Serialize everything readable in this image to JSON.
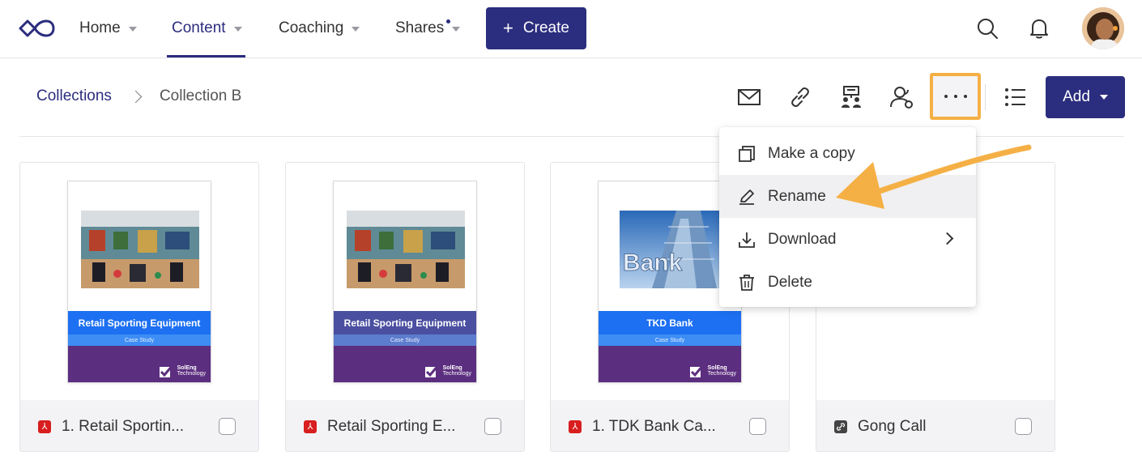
{
  "nav": {
    "items": [
      {
        "label": "Home"
      },
      {
        "label": "Content"
      },
      {
        "label": "Coaching"
      },
      {
        "label": "Shares"
      }
    ],
    "create_label": "Create"
  },
  "breadcrumb": {
    "parent": "Collections",
    "current": "Collection B"
  },
  "toolbar": {
    "add_label": "Add"
  },
  "menu": {
    "items": [
      {
        "label": "Make a copy",
        "icon": "copy-icon"
      },
      {
        "label": "Rename",
        "icon": "pencil-icon"
      },
      {
        "label": "Download",
        "icon": "download-icon"
      },
      {
        "label": "Delete",
        "icon": "trash-icon"
      }
    ]
  },
  "cards": [
    {
      "title": "1. Retail Sportin...",
      "file_type": "pdf",
      "doc_title": "Retail Sporting Equipment",
      "doc_sub": "Case Study",
      "logo_line1": "SolEng",
      "logo_line2": "Technology"
    },
    {
      "title": "Retail Sporting E...",
      "file_type": "pdf",
      "doc_title": "Retail Sporting Equipment",
      "doc_sub": "Case Study",
      "logo_line1": "SolEng",
      "logo_line2": "Technology"
    },
    {
      "title": "1. TDK Bank Ca...",
      "file_type": "pdf",
      "doc_title": "TKD Bank",
      "doc_sub": "Case Study",
      "logo_line1": "SolEng",
      "logo_line2": "Technology",
      "image_text": "Bank"
    },
    {
      "title": "Gong Call",
      "file_type": "link"
    }
  ],
  "colors": {
    "brand": "#2b2d7e",
    "highlight": "#f5b045",
    "pdf": "#d81e1e"
  }
}
